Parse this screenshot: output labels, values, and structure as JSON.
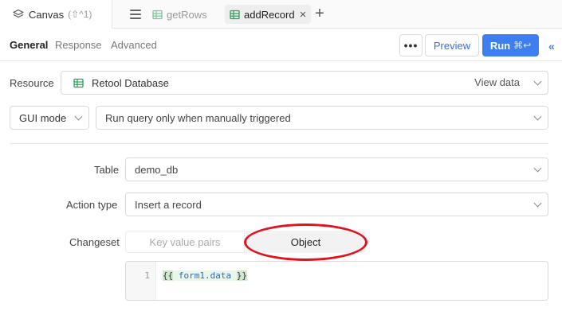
{
  "topbar": {
    "canvas_label": "Canvas",
    "canvas_shortcut": "(⇧^1)",
    "tabs": [
      {
        "label": "getRows",
        "icon": "table-icon",
        "active": false
      },
      {
        "label": "addRecord",
        "icon": "table-icon",
        "active": true
      }
    ]
  },
  "toolbar": {
    "subtabs": [
      {
        "label": "General",
        "active": true
      },
      {
        "label": "Response",
        "active": false
      },
      {
        "label": "Advanced",
        "active": false
      }
    ],
    "more_label": "•••",
    "preview_label": "Preview",
    "run_label": "Run",
    "run_shortcut": "⌘↩",
    "collapse_label": "«"
  },
  "form": {
    "resource_label": "Resource",
    "resource_value": "Retool Database",
    "view_data_label": "View data",
    "mode_value": "GUI mode",
    "trigger_value": "Run query only when manually triggered",
    "table_label": "Table",
    "table_value": "demo_db",
    "action_label": "Action type",
    "action_value": "Insert a record",
    "changeset_label": "Changeset",
    "changeset_options": [
      "Key value pairs",
      "Object"
    ],
    "changeset_selected": "Object",
    "code_line_number": "1",
    "code_open": "{{",
    "code_body": " form1.data ",
    "code_close": "}}"
  },
  "colors": {
    "accent": "#3d7ef0",
    "table_icon_green": "#2e9f5a",
    "annotation_red": "#e0141e"
  }
}
